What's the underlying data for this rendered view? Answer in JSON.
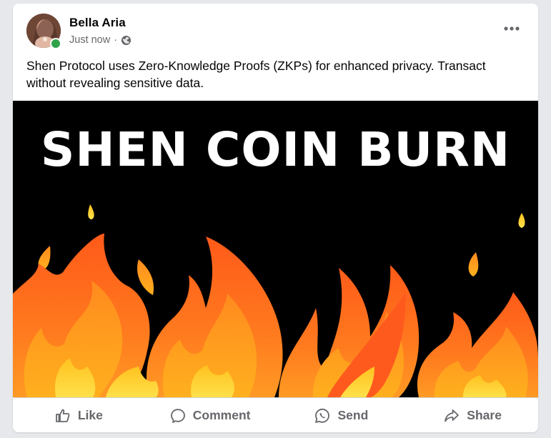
{
  "post": {
    "author": "Bella Aria",
    "timestamp": "Just now",
    "separator": "·",
    "privacy_icon": "globe-icon",
    "text": "Shen Protocol uses Zero-Knowledge Proofs (ZKPs) for enhanced privacy. Transact without revealing sensitive data.",
    "image": {
      "headline": "SHEN COIN BURN",
      "background_color": "#000000",
      "flame_colors": [
        "#ff6a1a",
        "#ff9a1f",
        "#ffd21f"
      ]
    }
  },
  "actions": {
    "like": {
      "label": "Like",
      "icon": "thumbs-up-icon"
    },
    "comment": {
      "label": "Comment",
      "icon": "comment-bubble-icon"
    },
    "send": {
      "label": "Send",
      "icon": "whatsapp-icon"
    },
    "share": {
      "label": "Share",
      "icon": "share-arrow-icon"
    }
  },
  "colors": {
    "online_indicator": "#31a24c",
    "secondary_text": "#65676b",
    "primary_text": "#050505"
  }
}
